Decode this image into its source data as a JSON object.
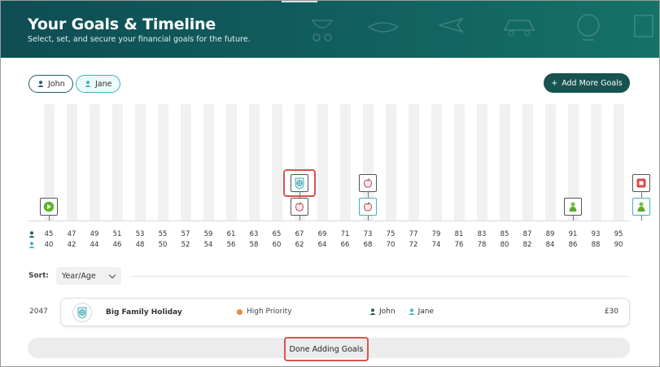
{
  "header": {
    "title": "Your Goals & Timeline",
    "subtitle": "Select, set, and secure your financial goals for the future."
  },
  "people": [
    {
      "name": "John",
      "color": "#1d5f5e"
    },
    {
      "name": "Jane",
      "color": "#3fb3bd"
    }
  ],
  "actions": {
    "add_goals_label": "Add More Goals",
    "done_label": "Done Adding Goals"
  },
  "timeline": {
    "john_ages": [
      "45",
      "47",
      "49",
      "51",
      "53",
      "55",
      "57",
      "59",
      "61",
      "63",
      "65",
      "67",
      "69",
      "71",
      "73",
      "75",
      "77",
      "79",
      "81",
      "83",
      "85",
      "87",
      "89",
      "91",
      "93",
      "95"
    ],
    "jane_ages": [
      "40",
      "42",
      "44",
      "46",
      "48",
      "50",
      "52",
      "54",
      "56",
      "58",
      "60",
      "62",
      "64",
      "66",
      "68",
      "70",
      "72",
      "74",
      "76",
      "78",
      "80",
      "82",
      "84",
      "86",
      "88",
      "90"
    ],
    "markers": [
      {
        "icon": "play-icon",
        "age_index": 0,
        "level": 0,
        "owner": "john"
      },
      {
        "icon": "holiday-globe-icon",
        "age_index": 11,
        "level": 1,
        "owner": "john",
        "highlighted": true
      },
      {
        "icon": "apple-icon",
        "age_index": 11,
        "level": 0,
        "owner": "john"
      },
      {
        "icon": "apple-icon",
        "age_index": 14,
        "level": 1,
        "owner": "john"
      },
      {
        "icon": "apple-icon",
        "age_index": 14,
        "level": 0,
        "owner": "jane"
      },
      {
        "icon": "elderly-icon",
        "age_index": 23,
        "level": 0,
        "owner": "john"
      },
      {
        "icon": "stop-icon",
        "age_index": 26,
        "level": 1,
        "owner": "john"
      },
      {
        "icon": "elderly-icon",
        "age_index": 26,
        "level": 0,
        "owner": "jane"
      }
    ]
  },
  "sort": {
    "label": "Sort:",
    "value": "Year/Age"
  },
  "goals": [
    {
      "year": "2047",
      "icon": "holiday-globe-icon",
      "name": "Big Family Holiday",
      "priority": "High Priority",
      "priority_color": "#ec8a3c",
      "people": [
        "John",
        "Jane"
      ],
      "amount": "£30"
    }
  ]
}
